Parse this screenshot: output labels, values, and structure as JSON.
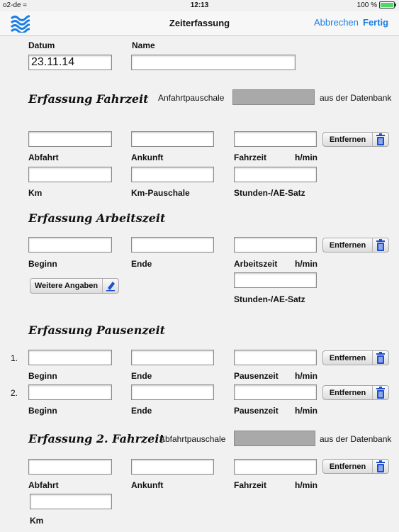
{
  "status": {
    "carrier": "o2-de",
    "time": "12:13",
    "battery": "100 %"
  },
  "nav": {
    "title": "Zeiterfassung",
    "cancel": "Abbrechen",
    "done": "Fertig"
  },
  "header": {
    "date_label": "Datum",
    "date_value": "23.11.14",
    "name_label": "Name",
    "name_value": ""
  },
  "drive": {
    "title": "Erfassung Fahrzeit",
    "flat_label": "Anfahrtpauschale",
    "from_db": "aus der Datenbank",
    "remove": "Entfernen",
    "departure": "Abfahrt",
    "arrival": "Ankunft",
    "duration": "Fahrzeit",
    "unit": "h/min",
    "km": "Km",
    "km_flat": "Km-Pauschale",
    "rate": "Stunden-/AE-Satz"
  },
  "work": {
    "title": "Erfassung Arbeitszeit",
    "remove": "Entfernen",
    "start": "Beginn",
    "end": "Ende",
    "duration": "Arbeitszeit",
    "unit": "h/min",
    "more": "Weitere Angaben",
    "rate": "Stunden-/AE-Satz"
  },
  "breaks": {
    "title": "Erfassung Pausenzeit",
    "rows": [
      {
        "num": "1.",
        "start": "Beginn",
        "end": "Ende",
        "duration": "Pausenzeit",
        "unit": "h/min",
        "remove": "Entfernen"
      },
      {
        "num": "2.",
        "start": "Beginn",
        "end": "Ende",
        "duration": "Pausenzeit",
        "unit": "h/min",
        "remove": "Entfernen"
      }
    ]
  },
  "drive2": {
    "title": "Erfassung 2. Fahrzeit",
    "flat_label": "Abfahrtpauschale",
    "from_db": "aus der Datenbank",
    "remove": "Entfernen",
    "departure": "Abfahrt",
    "arrival": "Ankunft",
    "duration": "Fahrzeit",
    "unit": "h/min",
    "km": "Km"
  },
  "colors": {
    "accent": "#1a7ee6",
    "trash": "#1f4fd1",
    "gray_field": "#a9a9a9"
  }
}
